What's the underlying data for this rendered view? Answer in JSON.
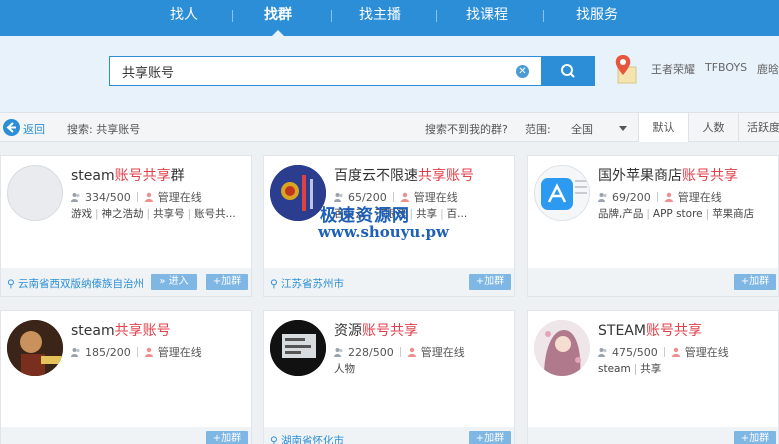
{
  "nav": {
    "tabs": [
      {
        "label": "找人"
      },
      {
        "label": "找群"
      },
      {
        "label": "找主播"
      },
      {
        "label": "找课程"
      },
      {
        "label": "找服务"
      }
    ],
    "active_tab": "找群"
  },
  "search": {
    "value": "共享账号",
    "hot_words": [
      "王者荣耀",
      "TFBOYS",
      "鹿晗"
    ]
  },
  "filter": {
    "back_label": "返回",
    "search_label": "搜索: 共享账号",
    "not_found_label": "搜索不到我的群?",
    "scope_label": "范围:",
    "scope_value": "全国",
    "sort_tabs": [
      "默认",
      "人数",
      "活跃度"
    ]
  },
  "cards": [
    {
      "title_prefix": "steam",
      "title_highlight": "账号共享",
      "title_suffix": "群",
      "members": "334/500",
      "admin": "管理在线",
      "tags": [
        "游戏",
        "神之浩劫",
        "共享号",
        "账号共..."
      ],
      "location": "云南省西双版纳傣族自治州",
      "enter_label": "» 进入",
      "join_label": "+加群"
    },
    {
      "title_prefix": "百度云不限速",
      "title_highlight": "共享账号",
      "title_suffix": "",
      "members": "65/200",
      "admin": "管理在线",
      "tags": [
        "百度云",
        "不限速",
        "共享",
        "百..."
      ],
      "location": "江苏省苏州市",
      "join_label": "+加群"
    },
    {
      "title_prefix": "国外苹果商店",
      "title_highlight": "账号共享",
      "title_suffix": "",
      "members": "69/200",
      "admin": "管理在线",
      "tags": [
        "品牌,产品",
        "APP store",
        "苹果商店"
      ],
      "location": "",
      "join_label": "+加群"
    },
    {
      "title_prefix": "steam",
      "title_highlight": "共享账号",
      "title_suffix": "",
      "members": "185/200",
      "admin": "管理在线",
      "tags": [],
      "location": "",
      "join_label": "+加群"
    },
    {
      "title_prefix": "资源",
      "title_highlight": "账号共享",
      "title_suffix": "",
      "members": "228/500",
      "admin": "管理在线",
      "tags": [
        "人物"
      ],
      "location": "湖南省怀化市",
      "join_label": "+加群"
    },
    {
      "title_prefix": "STEAM",
      "title_highlight": "账号共享",
      "title_suffix": "",
      "members": "475/500",
      "admin": "管理在线",
      "tags": [
        "steam",
        "共享"
      ],
      "location": "",
      "join_label": "+加群"
    }
  ],
  "watermark": {
    "line1": "极速资源网",
    "line2": "www.shouyu.pw"
  },
  "colors": {
    "brand_blue": "#2b8ed6",
    "highlight_red": "#e0404a",
    "button_blue": "#7eb6e4"
  }
}
